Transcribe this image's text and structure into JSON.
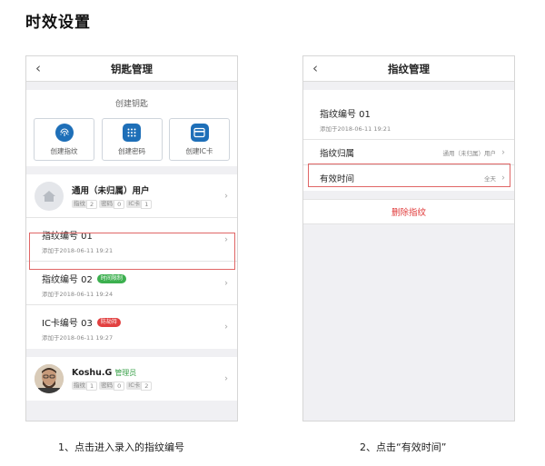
{
  "page": {
    "title": "时效设置"
  },
  "left_phone": {
    "nav_title": "钥匙管理",
    "create_label": "创建钥匙",
    "create_buttons": [
      {
        "label": "创建指纹",
        "icon": "fingerprint-icon"
      },
      {
        "label": "创建密码",
        "icon": "keypad-icon"
      },
      {
        "label": "创建IC卡",
        "icon": "card-icon"
      }
    ],
    "general_user": {
      "name": "通用（未归属）用户",
      "counts": [
        {
          "k": "指纹",
          "v": "2"
        },
        {
          "k": "密码",
          "v": "0"
        },
        {
          "k": "IC卡",
          "v": "1"
        }
      ]
    },
    "keys": [
      {
        "name": "指纹编号 01",
        "date": "添加于2018-06-11 19:21",
        "tag": ""
      },
      {
        "name": "指纹编号 02",
        "date": "添加于2018-06-11 19:24",
        "tag": "时间限制"
      },
      {
        "name": "IC卡编号 03",
        "date": "添加于2018-06-11 19:27",
        "tag": "防劫持"
      }
    ],
    "admin_user": {
      "name": "Koshu.G",
      "role": "管理员",
      "counts": [
        {
          "k": "指纹",
          "v": "1"
        },
        {
          "k": "密码",
          "v": "0"
        },
        {
          "k": "IC卡",
          "v": "2"
        }
      ]
    }
  },
  "right_phone": {
    "nav_title": "指纹管理",
    "key_name": "指纹编号 01",
    "key_date": "添加于2018-06-11 19:21",
    "owner_label": "指纹归属",
    "owner_value": "通用（未归属）用户",
    "validity_label": "有效时间",
    "validity_value": "全天",
    "delete_label": "删除指纹"
  },
  "captions": {
    "step1": "1、点击进入录入的指纹编号",
    "step2": "2、点击“有效时间”"
  },
  "colors": {
    "highlight": "#e06666",
    "primary_icon": "#1e6fb8",
    "tag_green": "#3cb04f",
    "tag_red": "#e24040",
    "delete": "#e03a3a"
  }
}
